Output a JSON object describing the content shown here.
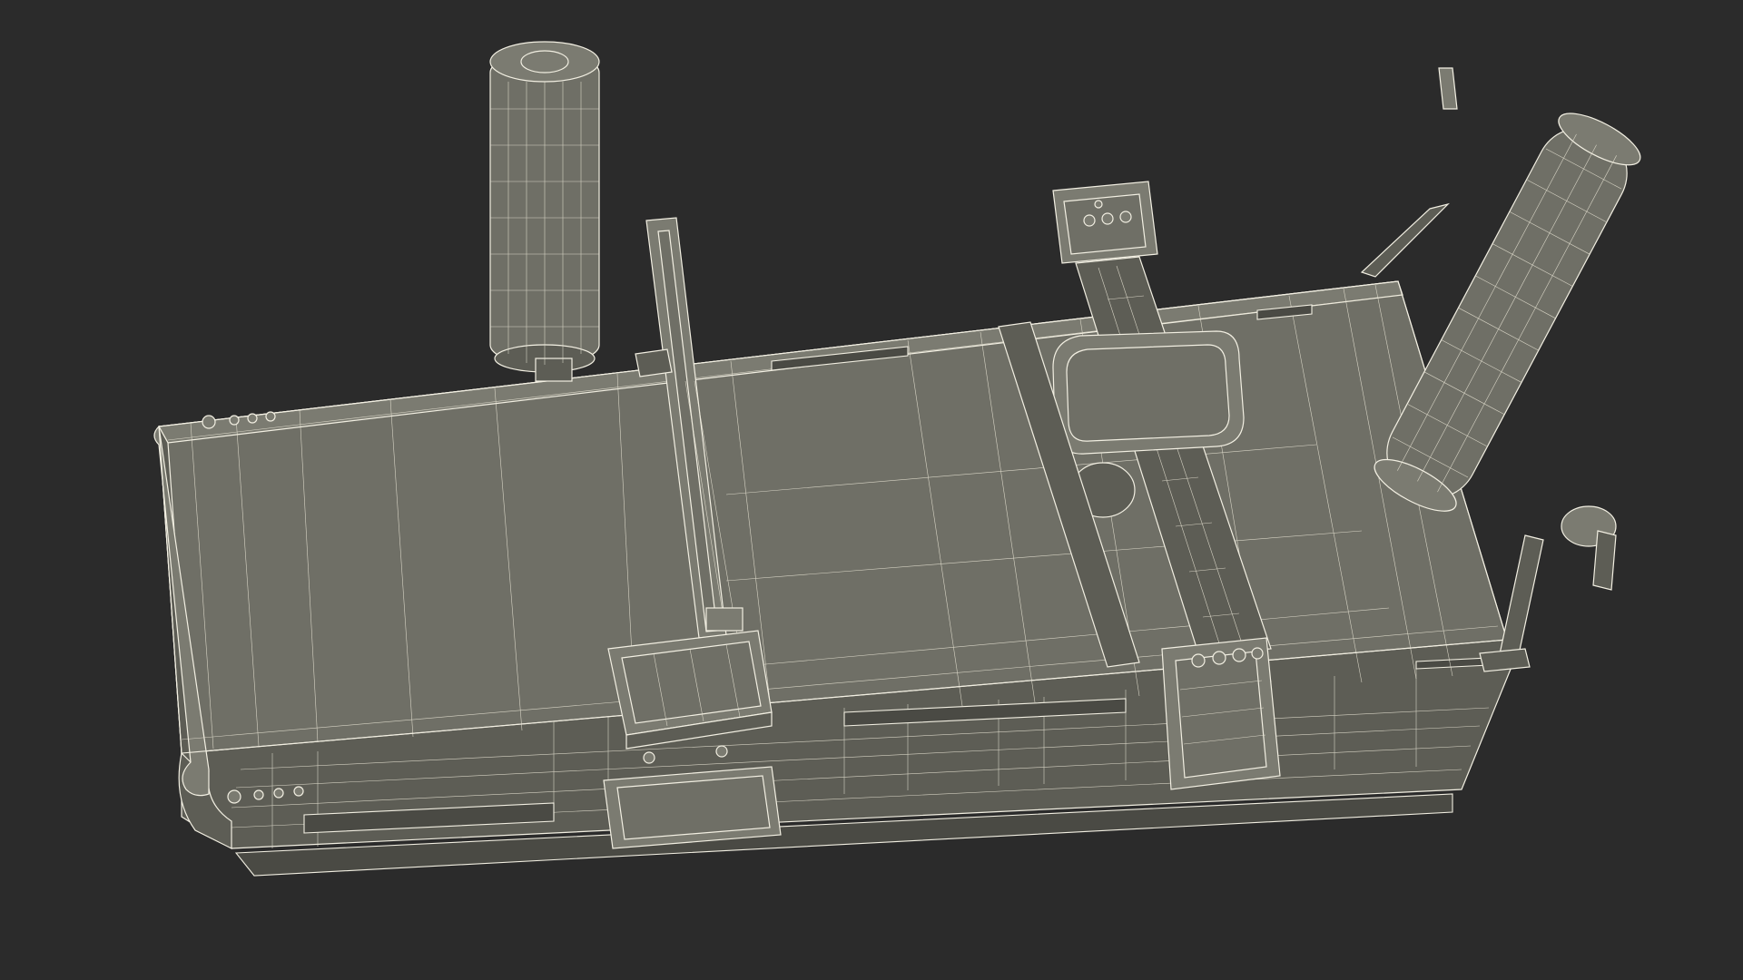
{
  "scene": {
    "background_color": "#2b2b2b",
    "wire_color": "#f2efe2",
    "surface_color": "#6f6f66",
    "subject": "wireframe-conveyor-cutting-machine"
  }
}
